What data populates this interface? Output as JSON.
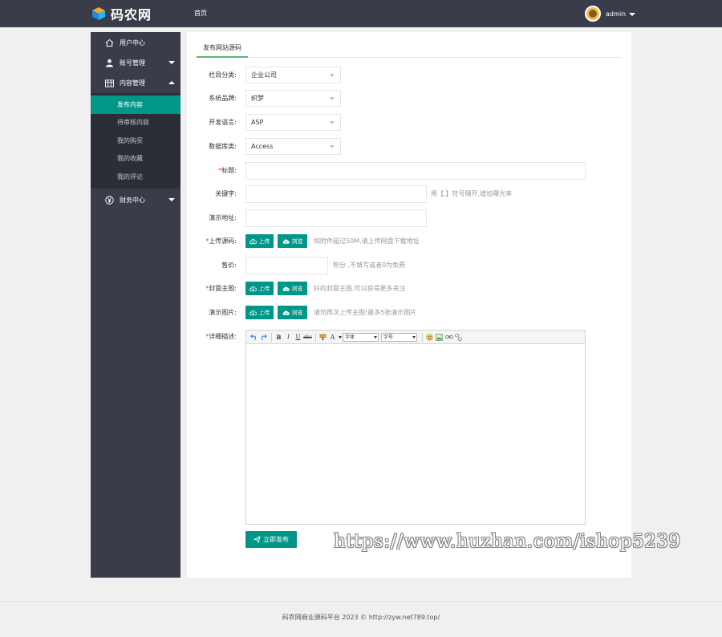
{
  "header": {
    "logo_text": "码农网",
    "nav_home": "首页",
    "user_name": "admin"
  },
  "sidebar": {
    "items": [
      {
        "label": "用户中心",
        "icon": "home-icon"
      },
      {
        "label": "账号管理",
        "icon": "user-icon"
      },
      {
        "label": "内容管理",
        "icon": "table-icon"
      },
      {
        "label": "财务中心",
        "icon": "yen-icon"
      }
    ],
    "sub_items": [
      {
        "label": "发布内容",
        "active": true
      },
      {
        "label": "待审核内容"
      },
      {
        "label": "我的购买"
      },
      {
        "label": "我的收藏"
      },
      {
        "label": "我的评论"
      }
    ]
  },
  "main": {
    "tab_label": "发布网站源码",
    "form": {
      "category": {
        "label": "栏目分类:",
        "value": "企业公司"
      },
      "brand": {
        "label": "系统品牌:",
        "value": "织梦"
      },
      "language": {
        "label": "开发语言:",
        "value": "ASP"
      },
      "database": {
        "label": "数据库类:",
        "value": "Access"
      },
      "title": {
        "label": "标题:",
        "required": "*"
      },
      "keywords": {
        "label": "关键字:",
        "hint": "用【,】符号隔开,增加曝光率"
      },
      "demo_url": {
        "label": "演示地址:"
      },
      "upload_source": {
        "label": "上传源码:",
        "required": "*",
        "upload": "上传",
        "browse": "浏览",
        "hint": "如附件超过50M,请上传网盘下载地址"
      },
      "price": {
        "label": "售价:",
        "hint": "积分 ,不填写或者0为免费"
      },
      "cover": {
        "label": "封面主图:",
        "required": "*",
        "upload": "上传",
        "browse": "浏览",
        "hint": "好的封面主图,可以获得更多关注"
      },
      "demo_images": {
        "label": "演示图片:",
        "upload": "上传",
        "browse": "浏览",
        "hint": "请勿再次上传主图!最多5张演示图片"
      },
      "description": {
        "label": "详细描述:",
        "required": "*"
      }
    },
    "editor": {
      "font_family": "字体",
      "font_size": "字号"
    },
    "submit_label": "立即发布"
  },
  "watermark": "https://www.huzhan.com/ishop5239",
  "footer": "码农网商业源码平台 2023 © http://zyw.net789.top/",
  "colors": {
    "accent": "#009688",
    "header_bg": "#393d49",
    "tab_underline": "#5fb878",
    "required": "#ff3300"
  }
}
